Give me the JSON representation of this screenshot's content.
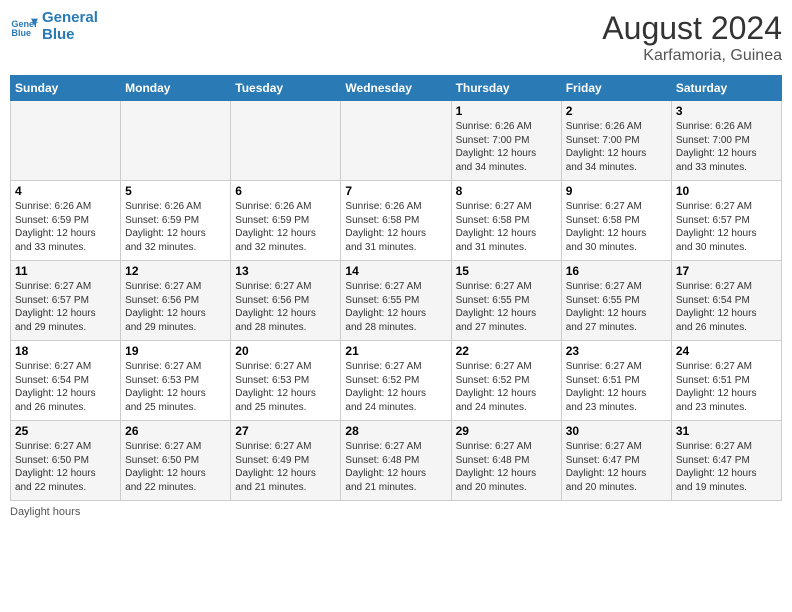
{
  "logo": {
    "line1": "General",
    "line2": "Blue"
  },
  "title": {
    "month_year": "August 2024",
    "location": "Karfamoria, Guinea"
  },
  "days_of_week": [
    "Sunday",
    "Monday",
    "Tuesday",
    "Wednesday",
    "Thursday",
    "Friday",
    "Saturday"
  ],
  "weeks": [
    [
      {
        "day": "",
        "info": ""
      },
      {
        "day": "",
        "info": ""
      },
      {
        "day": "",
        "info": ""
      },
      {
        "day": "",
        "info": ""
      },
      {
        "day": "1",
        "info": "Sunrise: 6:26 AM\nSunset: 7:00 PM\nDaylight: 12 hours\nand 34 minutes."
      },
      {
        "day": "2",
        "info": "Sunrise: 6:26 AM\nSunset: 7:00 PM\nDaylight: 12 hours\nand 34 minutes."
      },
      {
        "day": "3",
        "info": "Sunrise: 6:26 AM\nSunset: 7:00 PM\nDaylight: 12 hours\nand 33 minutes."
      }
    ],
    [
      {
        "day": "4",
        "info": "Sunrise: 6:26 AM\nSunset: 6:59 PM\nDaylight: 12 hours\nand 33 minutes."
      },
      {
        "day": "5",
        "info": "Sunrise: 6:26 AM\nSunset: 6:59 PM\nDaylight: 12 hours\nand 32 minutes."
      },
      {
        "day": "6",
        "info": "Sunrise: 6:26 AM\nSunset: 6:59 PM\nDaylight: 12 hours\nand 32 minutes."
      },
      {
        "day": "7",
        "info": "Sunrise: 6:26 AM\nSunset: 6:58 PM\nDaylight: 12 hours\nand 31 minutes."
      },
      {
        "day": "8",
        "info": "Sunrise: 6:27 AM\nSunset: 6:58 PM\nDaylight: 12 hours\nand 31 minutes."
      },
      {
        "day": "9",
        "info": "Sunrise: 6:27 AM\nSunset: 6:58 PM\nDaylight: 12 hours\nand 30 minutes."
      },
      {
        "day": "10",
        "info": "Sunrise: 6:27 AM\nSunset: 6:57 PM\nDaylight: 12 hours\nand 30 minutes."
      }
    ],
    [
      {
        "day": "11",
        "info": "Sunrise: 6:27 AM\nSunset: 6:57 PM\nDaylight: 12 hours\nand 29 minutes."
      },
      {
        "day": "12",
        "info": "Sunrise: 6:27 AM\nSunset: 6:56 PM\nDaylight: 12 hours\nand 29 minutes."
      },
      {
        "day": "13",
        "info": "Sunrise: 6:27 AM\nSunset: 6:56 PM\nDaylight: 12 hours\nand 28 minutes."
      },
      {
        "day": "14",
        "info": "Sunrise: 6:27 AM\nSunset: 6:55 PM\nDaylight: 12 hours\nand 28 minutes."
      },
      {
        "day": "15",
        "info": "Sunrise: 6:27 AM\nSunset: 6:55 PM\nDaylight: 12 hours\nand 27 minutes."
      },
      {
        "day": "16",
        "info": "Sunrise: 6:27 AM\nSunset: 6:55 PM\nDaylight: 12 hours\nand 27 minutes."
      },
      {
        "day": "17",
        "info": "Sunrise: 6:27 AM\nSunset: 6:54 PM\nDaylight: 12 hours\nand 26 minutes."
      }
    ],
    [
      {
        "day": "18",
        "info": "Sunrise: 6:27 AM\nSunset: 6:54 PM\nDaylight: 12 hours\nand 26 minutes."
      },
      {
        "day": "19",
        "info": "Sunrise: 6:27 AM\nSunset: 6:53 PM\nDaylight: 12 hours\nand 25 minutes."
      },
      {
        "day": "20",
        "info": "Sunrise: 6:27 AM\nSunset: 6:53 PM\nDaylight: 12 hours\nand 25 minutes."
      },
      {
        "day": "21",
        "info": "Sunrise: 6:27 AM\nSunset: 6:52 PM\nDaylight: 12 hours\nand 24 minutes."
      },
      {
        "day": "22",
        "info": "Sunrise: 6:27 AM\nSunset: 6:52 PM\nDaylight: 12 hours\nand 24 minutes."
      },
      {
        "day": "23",
        "info": "Sunrise: 6:27 AM\nSunset: 6:51 PM\nDaylight: 12 hours\nand 23 minutes."
      },
      {
        "day": "24",
        "info": "Sunrise: 6:27 AM\nSunset: 6:51 PM\nDaylight: 12 hours\nand 23 minutes."
      }
    ],
    [
      {
        "day": "25",
        "info": "Sunrise: 6:27 AM\nSunset: 6:50 PM\nDaylight: 12 hours\nand 22 minutes."
      },
      {
        "day": "26",
        "info": "Sunrise: 6:27 AM\nSunset: 6:50 PM\nDaylight: 12 hours\nand 22 minutes."
      },
      {
        "day": "27",
        "info": "Sunrise: 6:27 AM\nSunset: 6:49 PM\nDaylight: 12 hours\nand 21 minutes."
      },
      {
        "day": "28",
        "info": "Sunrise: 6:27 AM\nSunset: 6:48 PM\nDaylight: 12 hours\nand 21 minutes."
      },
      {
        "day": "29",
        "info": "Sunrise: 6:27 AM\nSunset: 6:48 PM\nDaylight: 12 hours\nand 20 minutes."
      },
      {
        "day": "30",
        "info": "Sunrise: 6:27 AM\nSunset: 6:47 PM\nDaylight: 12 hours\nand 20 minutes."
      },
      {
        "day": "31",
        "info": "Sunrise: 6:27 AM\nSunset: 6:47 PM\nDaylight: 12 hours\nand 19 minutes."
      }
    ]
  ],
  "footer": {
    "daylight_label": "Daylight hours"
  }
}
